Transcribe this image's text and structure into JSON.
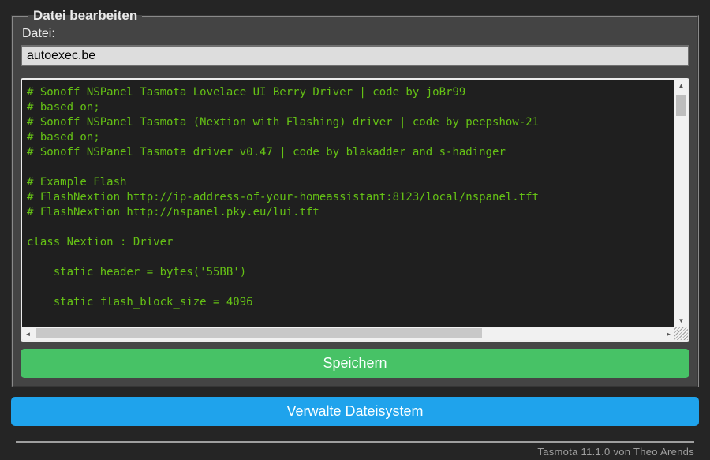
{
  "form": {
    "legend": "Datei bearbeiten",
    "file_label": "Datei:",
    "filename_value": "autoexec.be",
    "save_button_label": "Speichern"
  },
  "editor": {
    "code": "# Sonoff NSPanel Tasmota Lovelace UI Berry Driver | code by joBr99\n# based on;\n# Sonoff NSPanel Tasmota (Nextion with Flashing) driver | code by peepshow-21\n# based on;\n# Sonoff NSPanel Tasmota driver v0.47 | code by blakadder and s-hadinger\n\n# Example Flash\n# FlashNextion http://ip-address-of-your-homeassistant:8123/local/nspanel.tft\n# FlashNextion http://nspanel.pky.eu/lui.tft\n\nclass Nextion : Driver\n\n    static header = bytes('55BB')\n\n    static flash_block_size = 4096\n"
  },
  "buttons": {
    "manage_fs_label": "Verwalte Dateisystem"
  },
  "footer": {
    "text": "Tasmota 11.1.0 von Theo Arends"
  },
  "icons": {
    "scroll_up": "▲",
    "scroll_down": "▼",
    "scroll_left": "◄",
    "scroll_right": "►"
  },
  "colors": {
    "page_background": "#252525",
    "form_background": "#444444",
    "text": "#eaeaea",
    "input_background": "#dddddd",
    "input_text": "#000000",
    "console_background": "#1f1f1f",
    "console_text": "#65c115",
    "save_button": "#47c266",
    "manage_button": "#1fa3ec",
    "button_text": "#faffff",
    "footer_text": "#9f9f9f"
  }
}
